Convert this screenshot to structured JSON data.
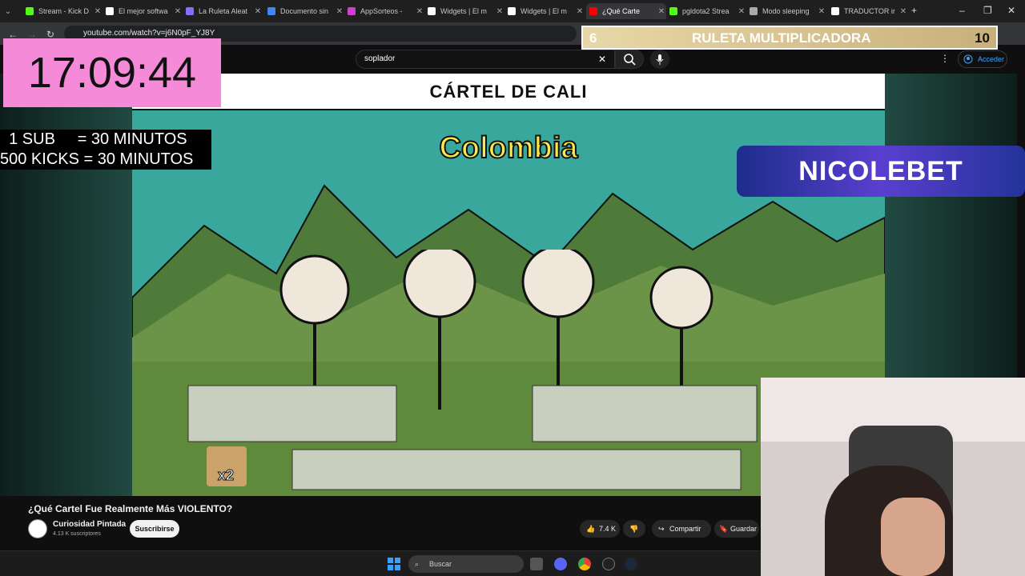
{
  "browser": {
    "tabs": [
      {
        "label": "Stream - Kick D",
        "color": "#53fc18"
      },
      {
        "label": "El mejor softwa",
        "color": "#ffffff"
      },
      {
        "label": "La Ruleta Aleat",
        "color": "#8a6cff"
      },
      {
        "label": "Documento sin",
        "color": "#4285f4"
      },
      {
        "label": "AppSorteos -",
        "color": "#d040d0"
      },
      {
        "label": "Widgets | El m",
        "color": "#ffffff"
      },
      {
        "label": "Widgets | El m",
        "color": "#ffffff"
      },
      {
        "label": "¿Qué Carte",
        "color": "#ff0000"
      },
      {
        "label": "pgldota2 Strea",
        "color": "#53fc18"
      },
      {
        "label": "Modo sleeping",
        "color": "#aaaaaa"
      },
      {
        "label": "TRADUCTOR ir",
        "color": "#ffffff"
      }
    ],
    "url": "youtube.com/watch?v=j6N0pF_YJ8Y"
  },
  "youtube": {
    "search_value": "soplador",
    "signin_label": "Acceder"
  },
  "overlays": {
    "clock": "17:09:44",
    "sub_line": "  1 SUB     = 30 MINUTOS",
    "kicks_line": "500 KICKS = 30 MINUTOS",
    "ruleta_left": "6",
    "ruleta_title": "RULETA MULTIPLICADORA",
    "ruleta_right": "10",
    "sponsor": "NICOLEBET",
    "multiplier": "x2"
  },
  "video_content": {
    "banner": "CÁRTEL DE CALI",
    "country": "Colombia"
  },
  "video_info": {
    "title": "¿Qué Cartel Fue Realmente Más VIOLENTO?",
    "channel": "Curiosidad Pintada",
    "subscribers": "4.13 K suscriptores",
    "subscribe_label": "Suscribirse",
    "likes": "7.4 K",
    "share_label": "Compartir",
    "save_label": "Guardar"
  },
  "taskbar": {
    "search_placeholder": "Buscar"
  }
}
